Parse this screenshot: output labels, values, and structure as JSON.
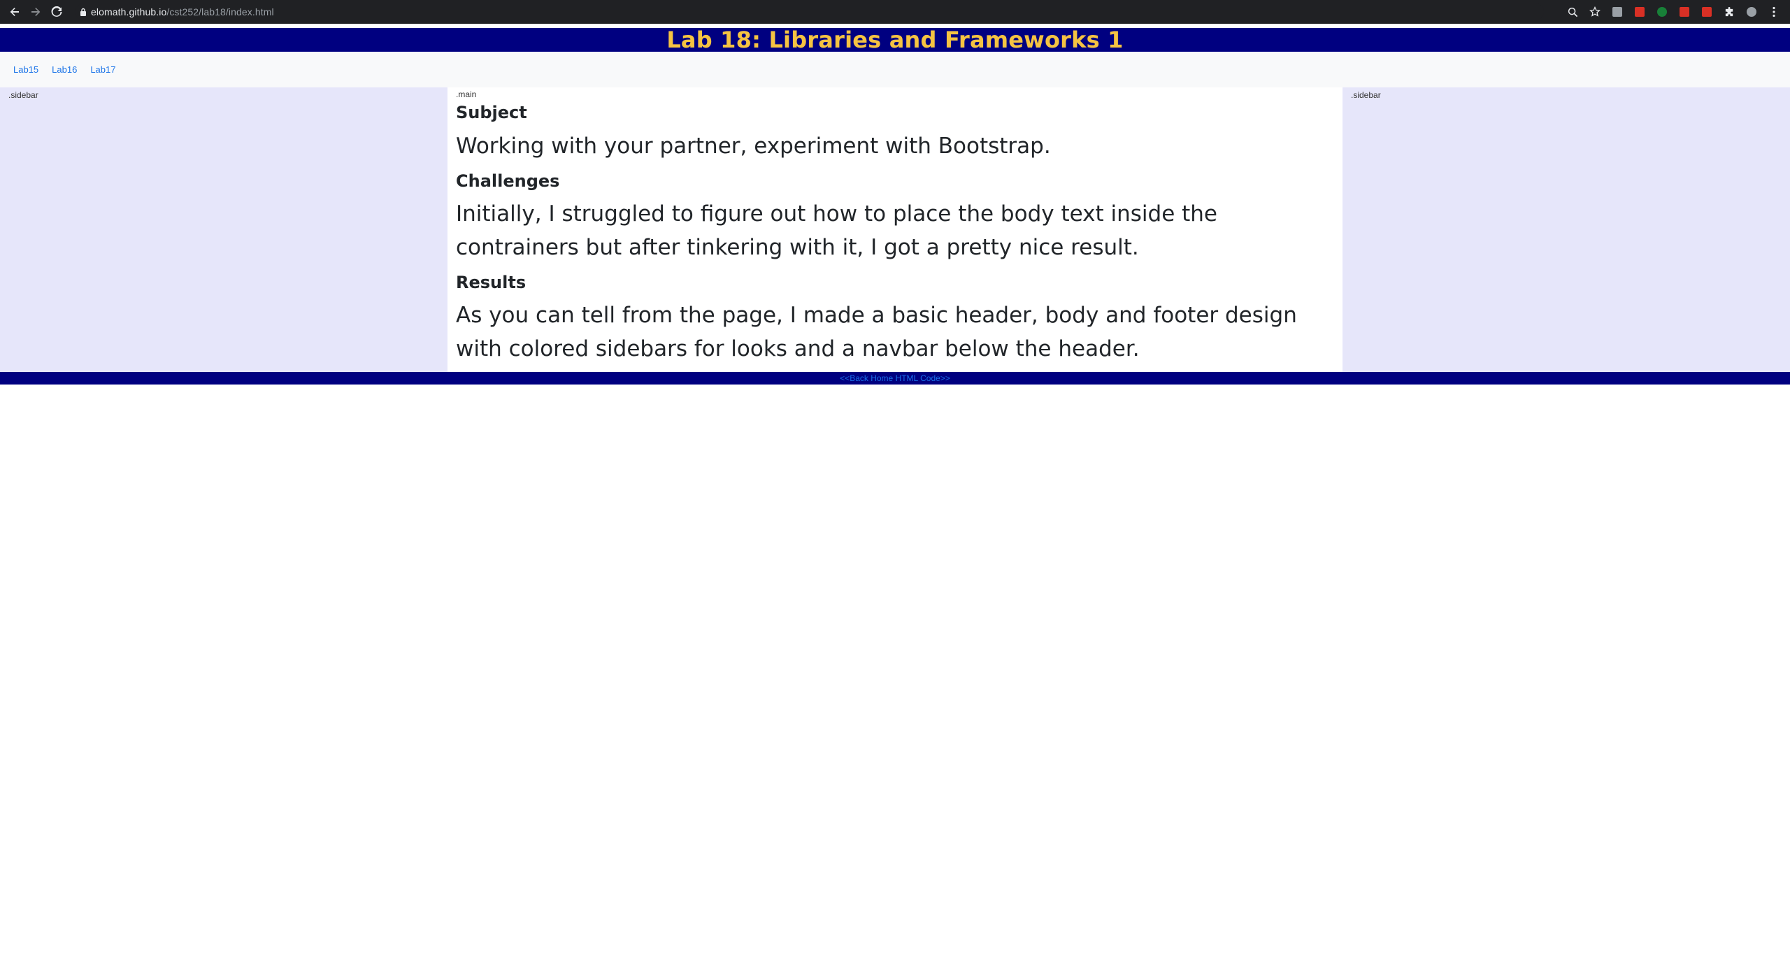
{
  "browser": {
    "url_host": "elomath.github.io",
    "url_path": "/cst252/lab18/index.html",
    "ext_colors": [
      "#9aa0a6",
      "#d93025",
      "#188038",
      "#d93025",
      "#d93025"
    ]
  },
  "header": {
    "title": "Lab 18: Libraries and Frameworks 1",
    "title_color": "#f5c342",
    "background": "#000080"
  },
  "navbar": {
    "links": [
      "Lab15",
      "Lab16",
      "Lab17"
    ]
  },
  "sidebar_left": {
    "label": ".sidebar"
  },
  "sidebar_right": {
    "label": ".sidebar"
  },
  "main": {
    "label": ".main",
    "subject_heading": "Subject",
    "subject_text": "Working with your partner, experiment with Bootstrap.",
    "challenges_heading": "Challenges",
    "challenges_text": "Initially, I struggled to figure out how to place the body text inside the contrainers but after tinkering with it, I got a pretty nice result.",
    "results_heading": "Results",
    "results_text": "As you can tell from the page, I made a basic header, body and footer design with colored sidebars for looks and a navbar below the header."
  },
  "footer": {
    "prefix": "<< ",
    "back_home": "Back Home",
    "html_code": "HTML Code",
    "suffix": " >>"
  }
}
